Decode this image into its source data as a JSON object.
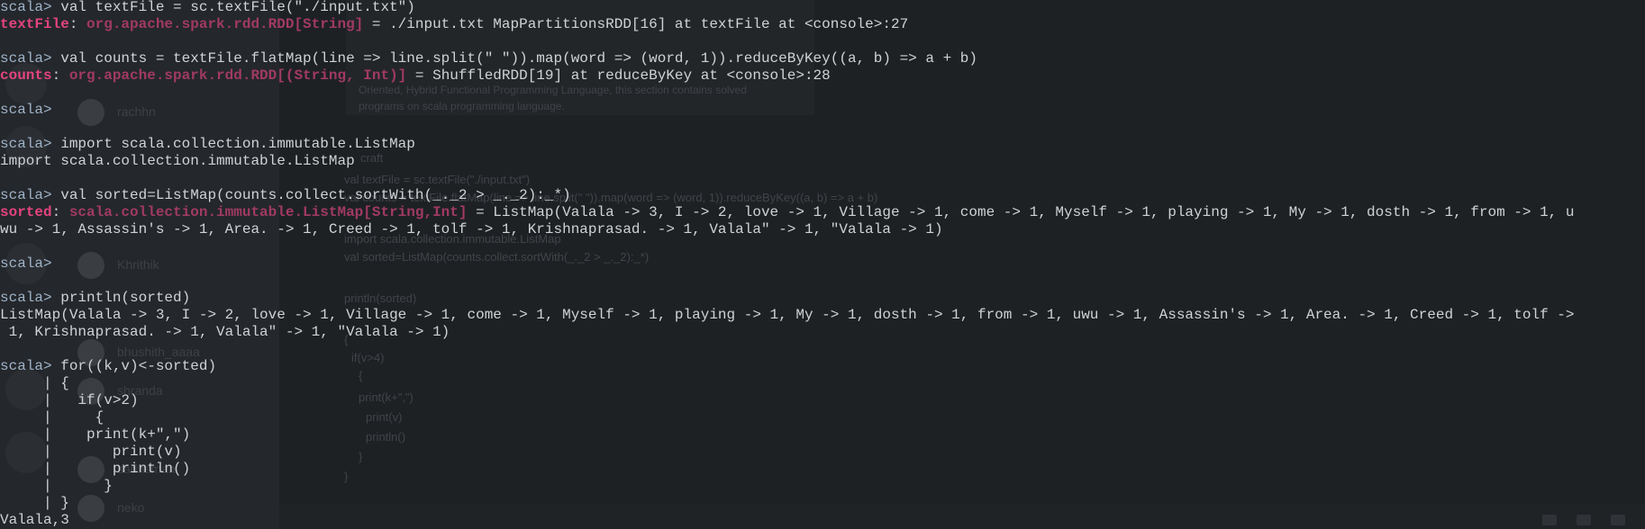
{
  "background_app": {
    "users": [
      "rachhn",
      "Khrithik",
      "bhushith_aaaa",
      "shranda",
      "sadhsman",
      "neko"
    ],
    "card_lines": [
      "Oriented, Hybrid Functional Programming Language, this section contains solved",
      "programs on scala programming language."
    ],
    "craft_label": "craft",
    "code_lines": [
      "val textFile = sc.textFile(\"./input.txt\")",
      "val counts = textFile.flatMap(line => line.split(\" \")).map(word => (word, 1)).reduceByKey((a, b) => a + b)",
      "import scala.collection.immutable.ListMap",
      "val sorted=ListMap(counts.collect.sortWith(_._2 > _._2):_*)",
      "println(sorted)",
      "{",
      "if(v>4)",
      "{",
      "print(k+\",\")",
      "print(v)",
      "println()",
      "}",
      "}"
    ]
  },
  "terminal": {
    "prompt": "scala>",
    "lines": [
      {
        "kind": "input",
        "text": " val textFile = sc.textFile(\"./input.txt\")"
      },
      {
        "kind": "result",
        "name": "textFile",
        "sep": ": ",
        "type": "org.apache.spark.rdd.RDD[String]",
        "rest": " = ./input.txt MapPartitionsRDD[16] at textFile at <console>:27"
      },
      {
        "kind": "blank"
      },
      {
        "kind": "input",
        "text": " val counts = textFile.flatMap(line => line.split(\" \")).map(word => (word, 1)).reduceByKey((a, b) => a + b)"
      },
      {
        "kind": "result",
        "name": "counts",
        "sep": ": ",
        "type": "org.apache.spark.rdd.RDD[(String, Int)]",
        "rest": " = ShuffledRDD[19] at reduceByKey at <console>:28"
      },
      {
        "kind": "blank"
      },
      {
        "kind": "input",
        "text": ""
      },
      {
        "kind": "blank"
      },
      {
        "kind": "input",
        "text": " import scala.collection.immutable.ListMap"
      },
      {
        "kind": "output",
        "text": "import scala.collection.immutable.ListMap"
      },
      {
        "kind": "blank"
      },
      {
        "kind": "input",
        "text": " val sorted=ListMap(counts.collect.sortWith(_._2 > _._2):_*)"
      },
      {
        "kind": "result",
        "name": "sorted",
        "sep": ": ",
        "type": "scala.collection.immutable.ListMap[String,Int]",
        "rest": " = ListMap(Valala -> 3, I -> 2, love -> 1, Village -> 1, come -> 1, Myself -> 1, playing -> 1, My -> 1, dosth -> 1, from -> 1, u"
      },
      {
        "kind": "output",
        "text": "wu -> 1, Assassin's -> 1, Area. -> 1, Creed -> 1, tolf -> 1, Krishnaprasad. -> 1, Valala\" -> 1, \"Valala -> 1)"
      },
      {
        "kind": "blank"
      },
      {
        "kind": "input",
        "text": ""
      },
      {
        "kind": "blank"
      },
      {
        "kind": "input",
        "text": " println(sorted)"
      },
      {
        "kind": "output",
        "text": "ListMap(Valala -> 3, I -> 2, love -> 1, Village -> 1, come -> 1, Myself -> 1, playing -> 1, My -> 1, dosth -> 1, from -> 1, uwu -> 1, Assassin's -> 1, Area. -> 1, Creed -> 1, tolf ->"
      },
      {
        "kind": "output",
        "text": " 1, Krishnaprasad. -> 1, Valala\" -> 1, \"Valala -> 1)"
      },
      {
        "kind": "blank"
      },
      {
        "kind": "input",
        "text": " for((k,v)<-sorted)"
      },
      {
        "kind": "output",
        "text": "     | {"
      },
      {
        "kind": "output",
        "text": "     |   if(v>2)"
      },
      {
        "kind": "output",
        "text": "     |     {"
      },
      {
        "kind": "output",
        "text": "     |    print(k+\",\")"
      },
      {
        "kind": "output",
        "text": "     |       print(v)"
      },
      {
        "kind": "output",
        "text": "     |       println()"
      },
      {
        "kind": "output",
        "text": "     |      }"
      },
      {
        "kind": "output",
        "text": "     | }"
      },
      {
        "kind": "output",
        "text": "Valala,3"
      }
    ]
  }
}
